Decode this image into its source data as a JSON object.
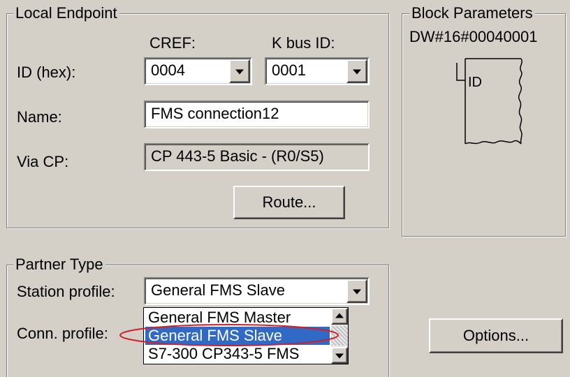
{
  "local_endpoint": {
    "title": "Local Endpoint",
    "cref_label": "CREF:",
    "kbus_label": "K bus ID:",
    "id_label": "ID (hex):",
    "cref_value": "0004",
    "kbus_value": "0001",
    "name_label": "Name:",
    "name_value": "FMS connection12",
    "via_label": "Via CP:",
    "via_value": "CP 443-5 Basic - (R0/S5)",
    "route_button": "Route..."
  },
  "block_parameters": {
    "title": "Block Parameters",
    "dw_value": "DW#16#00040001",
    "id_tag": "ID"
  },
  "partner_type": {
    "title": "Partner Type",
    "station_label": "Station profile:",
    "station_value": "General FMS Slave",
    "conn_label": "Conn. profile:",
    "options": [
      "General FMS Master",
      "General FMS Slave",
      "S7-300 CP343-5 FMS"
    ],
    "selected_index": 1
  },
  "options_button": "Options...",
  "colors": {
    "background": "#d4d0c8",
    "selection": "#316ac5",
    "highlight_ellipse": "#d0202a"
  }
}
